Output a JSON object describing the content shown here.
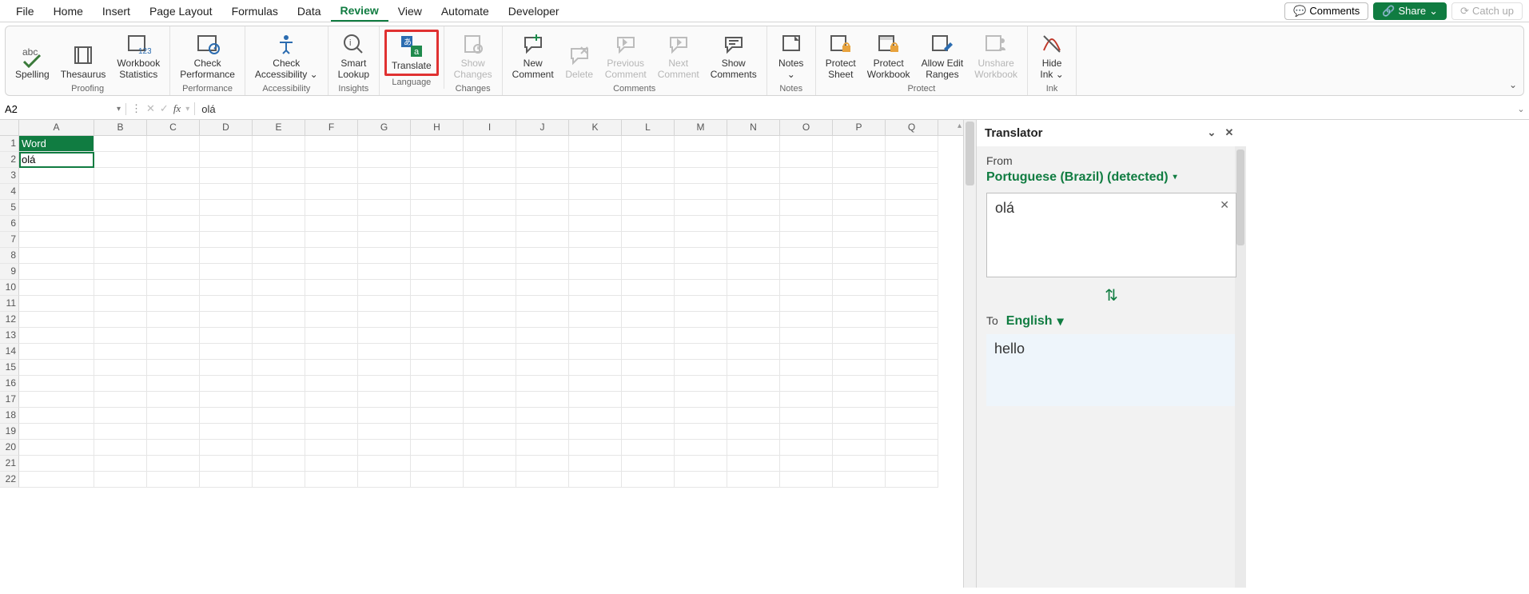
{
  "tabs": {
    "items": [
      "File",
      "Home",
      "Insert",
      "Page Layout",
      "Formulas",
      "Data",
      "Review",
      "View",
      "Automate",
      "Developer"
    ],
    "active": "Review",
    "right": {
      "comments": "Comments",
      "share": "Share",
      "catchup": "Catch up"
    }
  },
  "ribbon": {
    "groups": [
      {
        "label": "Proofing",
        "items": [
          {
            "name": "spelling",
            "label": "Spelling",
            "disabled": false
          },
          {
            "name": "thesaurus",
            "label": "Thesaurus",
            "disabled": false
          },
          {
            "name": "workbook-statistics",
            "label": "Workbook\nStatistics",
            "disabled": false
          }
        ]
      },
      {
        "label": "Performance",
        "items": [
          {
            "name": "check-performance",
            "label": "Check\nPerformance",
            "disabled": false
          }
        ]
      },
      {
        "label": "Accessibility",
        "items": [
          {
            "name": "check-accessibility",
            "label": "Check\nAccessibility ⌄",
            "disabled": false
          }
        ]
      },
      {
        "label": "Insights",
        "items": [
          {
            "name": "smart-lookup",
            "label": "Smart\nLookup",
            "disabled": false
          }
        ]
      },
      {
        "label": "Language",
        "items": [
          {
            "name": "translate",
            "label": "Translate",
            "disabled": false,
            "highlight": true
          }
        ]
      },
      {
        "label": "Changes",
        "items": [
          {
            "name": "show-changes",
            "label": "Show\nChanges",
            "disabled": true
          }
        ]
      },
      {
        "label": "Comments",
        "items": [
          {
            "name": "new-comment",
            "label": "New\nComment",
            "disabled": false
          },
          {
            "name": "delete-comment",
            "label": "Delete",
            "disabled": true
          },
          {
            "name": "previous-comment",
            "label": "Previous\nComment",
            "disabled": true
          },
          {
            "name": "next-comment",
            "label": "Next\nComment",
            "disabled": true
          },
          {
            "name": "show-comments",
            "label": "Show\nComments",
            "disabled": false
          }
        ]
      },
      {
        "label": "Notes",
        "items": [
          {
            "name": "notes",
            "label": "Notes\n⌄",
            "disabled": false
          }
        ]
      },
      {
        "label": "Protect",
        "items": [
          {
            "name": "protect-sheet",
            "label": "Protect\nSheet",
            "disabled": false
          },
          {
            "name": "protect-workbook",
            "label": "Protect\nWorkbook",
            "disabled": false
          },
          {
            "name": "allow-edit-ranges",
            "label": "Allow Edit\nRanges",
            "disabled": false
          },
          {
            "name": "unshare-workbook",
            "label": "Unshare\nWorkbook",
            "disabled": true
          }
        ]
      },
      {
        "label": "Ink",
        "items": [
          {
            "name": "hide-ink",
            "label": "Hide\nInk ⌄",
            "disabled": false
          }
        ]
      }
    ]
  },
  "formula_bar": {
    "name_box": "A2",
    "formula": "olá"
  },
  "grid": {
    "columns": [
      "A",
      "B",
      "C",
      "D",
      "E",
      "F",
      "G",
      "H",
      "I",
      "J",
      "K",
      "L",
      "M",
      "N",
      "O",
      "P",
      "Q"
    ],
    "row_count": 22,
    "cells": {
      "A1": {
        "value": "Word",
        "style": "header"
      },
      "A2": {
        "value": "olá",
        "style": "selected"
      }
    }
  },
  "translator": {
    "title": "Translator",
    "from_label": "From",
    "from_lang": "Portuguese (Brazil) (detected)",
    "from_text": "olá",
    "to_label": "To",
    "to_lang": "English",
    "to_text": "hello"
  }
}
